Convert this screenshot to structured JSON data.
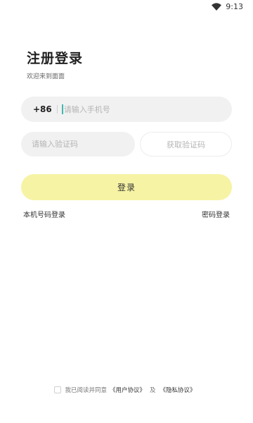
{
  "status_bar": {
    "time": "9:13",
    "icons": [
      "wifi-icon"
    ]
  },
  "header": {
    "title": "注册登录",
    "subtitle": "欢迎来到面面"
  },
  "form": {
    "country_code": "+86",
    "phone_placeholder": "请输入手机号",
    "phone_value": "",
    "code_placeholder": "请输入验证码",
    "code_value": "",
    "get_code_label": "获取验证码",
    "login_label": "登录"
  },
  "alt_login": {
    "local_number_label": "本机号码登录",
    "password_label": "密码登录"
  },
  "agreement": {
    "checked": false,
    "prefix": "我已阅读并同意",
    "user_agreement": "《用户协议》",
    "and": "及",
    "privacy_policy": "《隐私协议》"
  },
  "colors": {
    "accent": "#f6f3a4",
    "input_bg": "#f1f1f1",
    "caret": "#3fb8b0"
  }
}
